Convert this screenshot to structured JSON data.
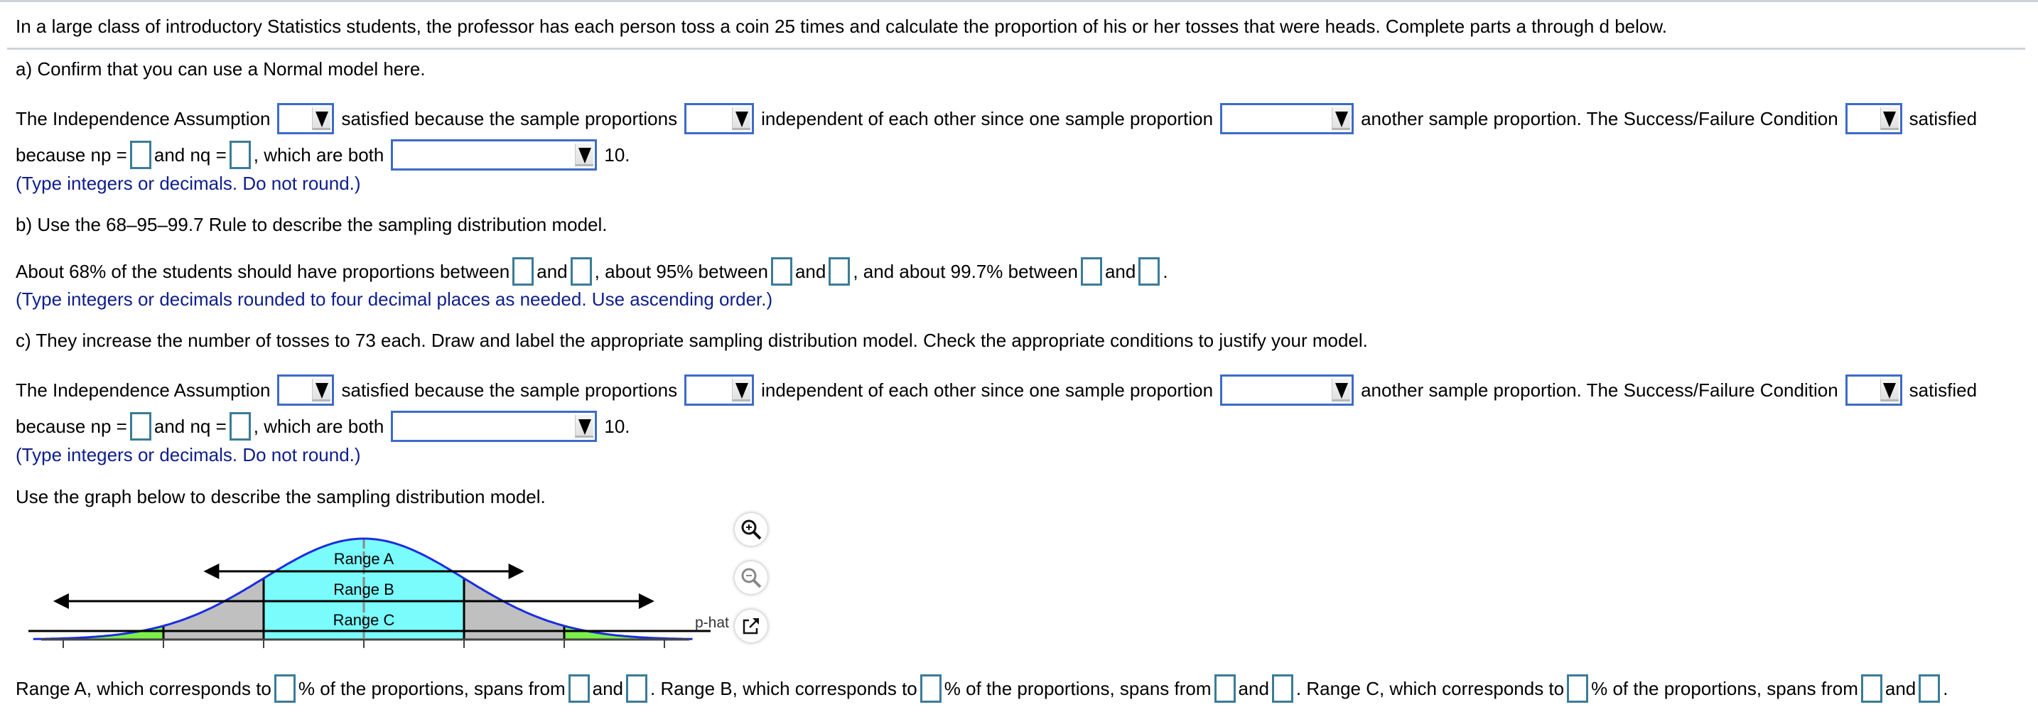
{
  "problem": {
    "intro": "In a large class of introductory Statistics students, the professor has each person toss a coin 25 times and calculate the proportion of his or her tosses that were heads. Complete parts a through d below."
  },
  "part_a": {
    "heading": "a) Confirm that you can use a Normal model here.",
    "t1": "The Independence Assumption",
    "t2": "satisfied because the sample proportions",
    "t3": "independent of each other since one sample proportion",
    "t4": "another sample proportion. The Success/Failure Condition",
    "t5": "satisfied",
    "t6": "because np =",
    "t7": "and nq =",
    "t8": ", which are both",
    "t9": "10.",
    "hint": "(Type integers or decimals. Do not round.)",
    "dropdowns": [
      "",
      "",
      "",
      "",
      ""
    ],
    "np_value": "",
    "nq_value": ""
  },
  "part_b": {
    "heading": "b) Use the 68–95–99.7 Rule to describe the sampling distribution model.",
    "t1": "About 68% of the students should have proportions between",
    "and": "and",
    "t2": ", about 95% between",
    "t3": ", and about 99.7% between",
    "end": ".",
    "hint": "(Type integers or decimals rounded to four decimal places as needed. Use ascending order.)",
    "values": [
      "",
      "",
      "",
      "",
      "",
      ""
    ]
  },
  "part_c": {
    "heading": "c) They increase the number of tosses to 73 each. Draw and label the appropriate sampling distribution model. Check the appropriate conditions to justify your model.",
    "t1": "The Independence Assumption",
    "t2": "satisfied because the sample proportions",
    "t3": "independent of each other since one sample proportion",
    "t4": "another sample proportion. The Success/Failure Condition",
    "t5": "satisfied",
    "t6": "because np =",
    "t7": "and nq =",
    "t8": ", which are both",
    "t9": "10.",
    "hint": "(Type integers or decimals. Do not round.)",
    "graph_intro": "Use the graph below to describe the sampling distribution model.",
    "graph": {
      "range_labels": [
        "Range A",
        "Range B",
        "Range C"
      ],
      "axis_label": "p-hat",
      "colors": {
        "curve": "#1a2ee0",
        "within_1sd": "#7afcfc",
        "within_2sd": "#c0c0c0",
        "within_3sd": "#7cf04a"
      },
      "tools": [
        "zoom-in",
        "zoom-out",
        "open-in-new-window"
      ]
    },
    "ranges": {
      "r1": "Range A, which corresponds to",
      "pct": "% of the proportions, spans from",
      "and": "and",
      "r2": ". Range B, which corresponds to",
      "r3": ". Range C, which corresponds to",
      "end": "."
    }
  }
}
